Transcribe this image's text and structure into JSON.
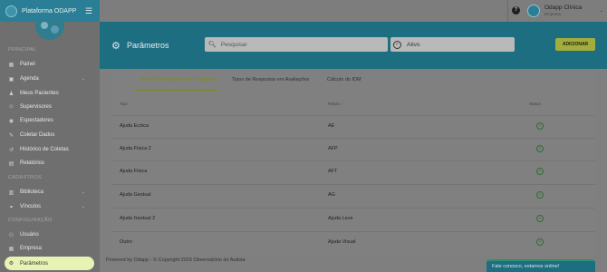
{
  "app": {
    "title": "Plataforma ODAPP"
  },
  "user": {
    "name": "Odapp Clínica",
    "role": "Empresa"
  },
  "sidebar": {
    "sections": [
      "PRINCIPAL",
      "CADASTROS",
      "CONFIGURAÇÃO"
    ],
    "items": [
      {
        "label": "Painel",
        "icon": "dashboard-icon"
      },
      {
        "label": "Agenda",
        "icon": "calendar-icon"
      },
      {
        "label": "Meus Pacientes",
        "icon": "people-icon"
      },
      {
        "label": "Supervisores",
        "icon": "supervisor-icon"
      },
      {
        "label": "Espectadores",
        "icon": "eye-icon"
      },
      {
        "label": "Coletar Dados",
        "icon": "pencil-icon"
      },
      {
        "label": "Histórico de Coletas",
        "icon": "history-icon"
      },
      {
        "label": "Relatórios",
        "icon": "report-icon"
      },
      {
        "label": "Biblioteca",
        "icon": "library-icon"
      },
      {
        "label": "Vínculos",
        "icon": "link-icon"
      },
      {
        "label": "Usuário",
        "icon": "user-icon"
      },
      {
        "label": "Empresa",
        "icon": "company-icon"
      },
      {
        "label": "Parâmetros",
        "icon": "gear-icon"
      }
    ]
  },
  "header": {
    "title": "Parâmetros",
    "search_placeholder": "Pesquisar",
    "filter_value": "Ativo",
    "add_label": "ADICIONAR"
  },
  "tabs": [
    "Tipos de Respostas em Programas",
    "Tipos de Respostas em Avaliações",
    "Cálculo do IDM"
  ],
  "table": {
    "headers": {
      "tipo": "Tipo",
      "rotulo": "Rótulo",
      "status": "Status"
    },
    "rows": [
      {
        "tipo": "Ajuda Ecóica",
        "rotulo": "AE"
      },
      {
        "tipo": "Ajuda Física 2",
        "rotulo": "AFP"
      },
      {
        "tipo": "Ajuda Física",
        "rotulo": "AFT"
      },
      {
        "tipo": "Ajuda Gestual",
        "rotulo": "AG"
      },
      {
        "tipo": "Ajuda Gestual 2",
        "rotulo": "Ajuda Leve"
      },
      {
        "tipo": "Outro",
        "rotulo": "Ajuda Visual"
      }
    ]
  },
  "footer": {
    "text": "Powered by Odapp - © Copyright 2023 Observatório do Autista"
  },
  "chat": {
    "label": "Fale conosco, estamos online!"
  },
  "colors": {
    "brand": "#1e6e82",
    "accent": "#a2ae3c",
    "active_bg": "#e7f3b5"
  }
}
